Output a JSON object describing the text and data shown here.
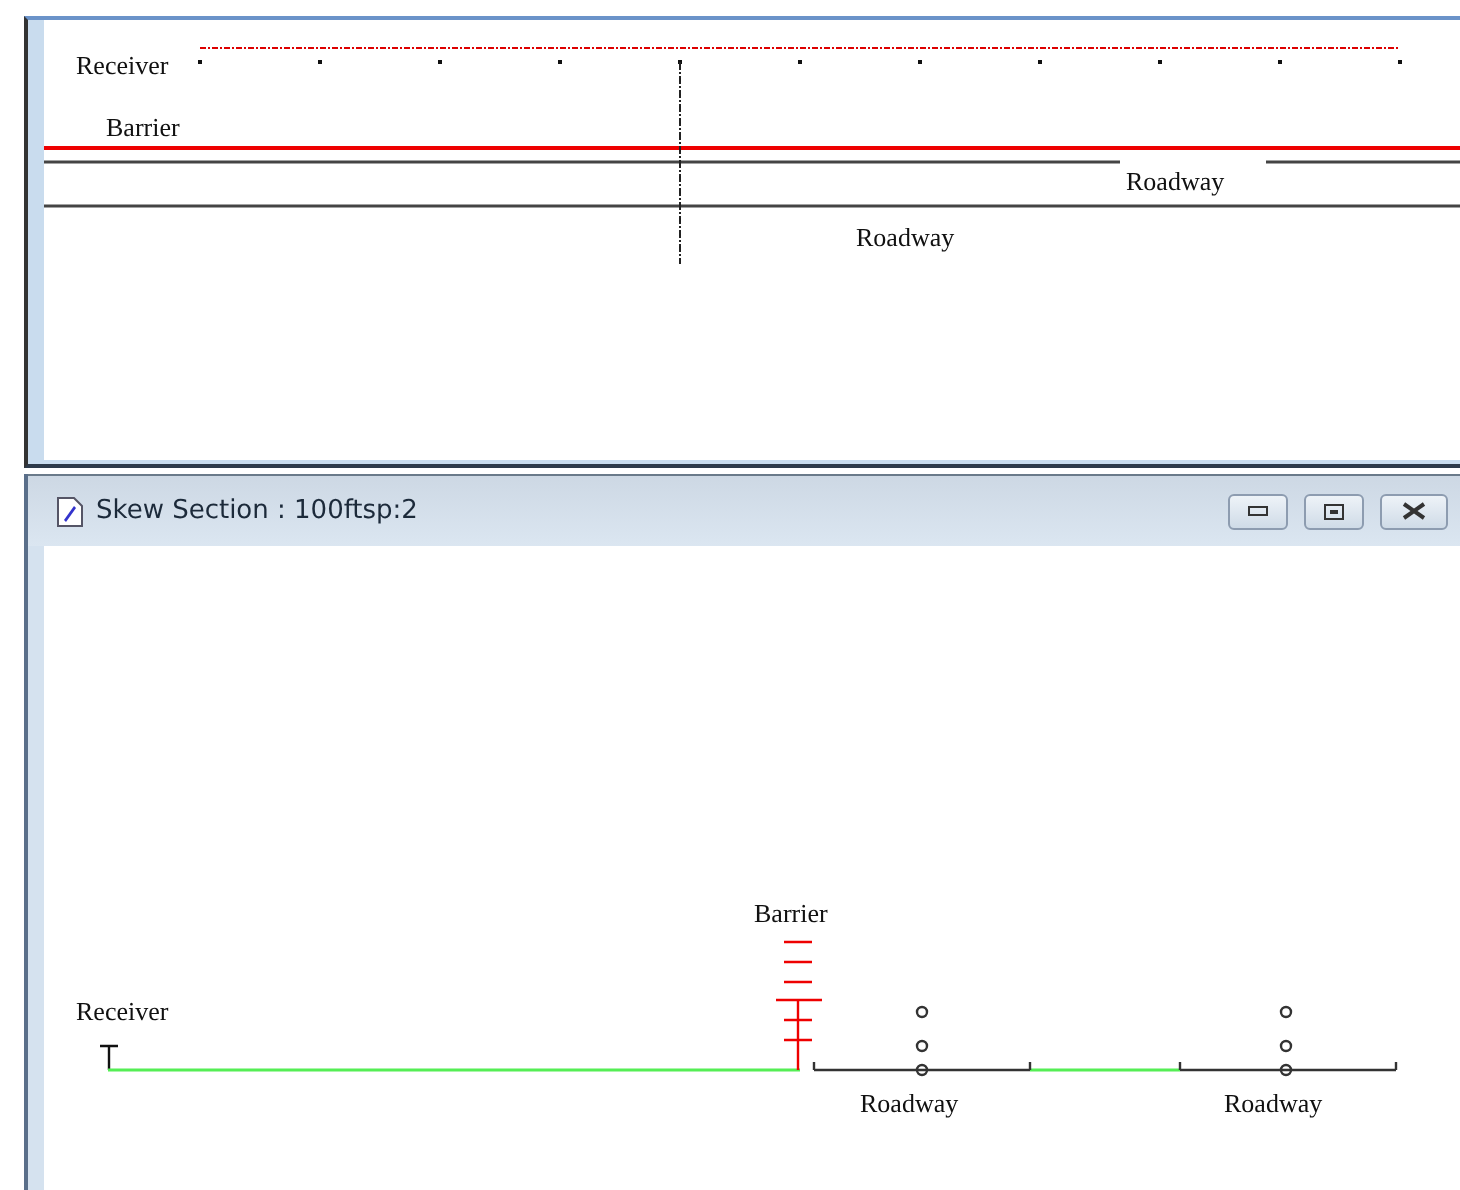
{
  "plan_window": {
    "labels": [
      {
        "text": "Receiver"
      },
      {
        "text": "Barrier"
      },
      {
        "text": "Roadway"
      },
      {
        "text": "Roadway"
      }
    ]
  },
  "section_window": {
    "title": "Skew Section : 100ftsp:2",
    "labels": [
      {
        "text": "Receiver"
      },
      {
        "text": "Barrier"
      },
      {
        "text": "Roadway"
      },
      {
        "text": "Roadway"
      }
    ]
  }
}
